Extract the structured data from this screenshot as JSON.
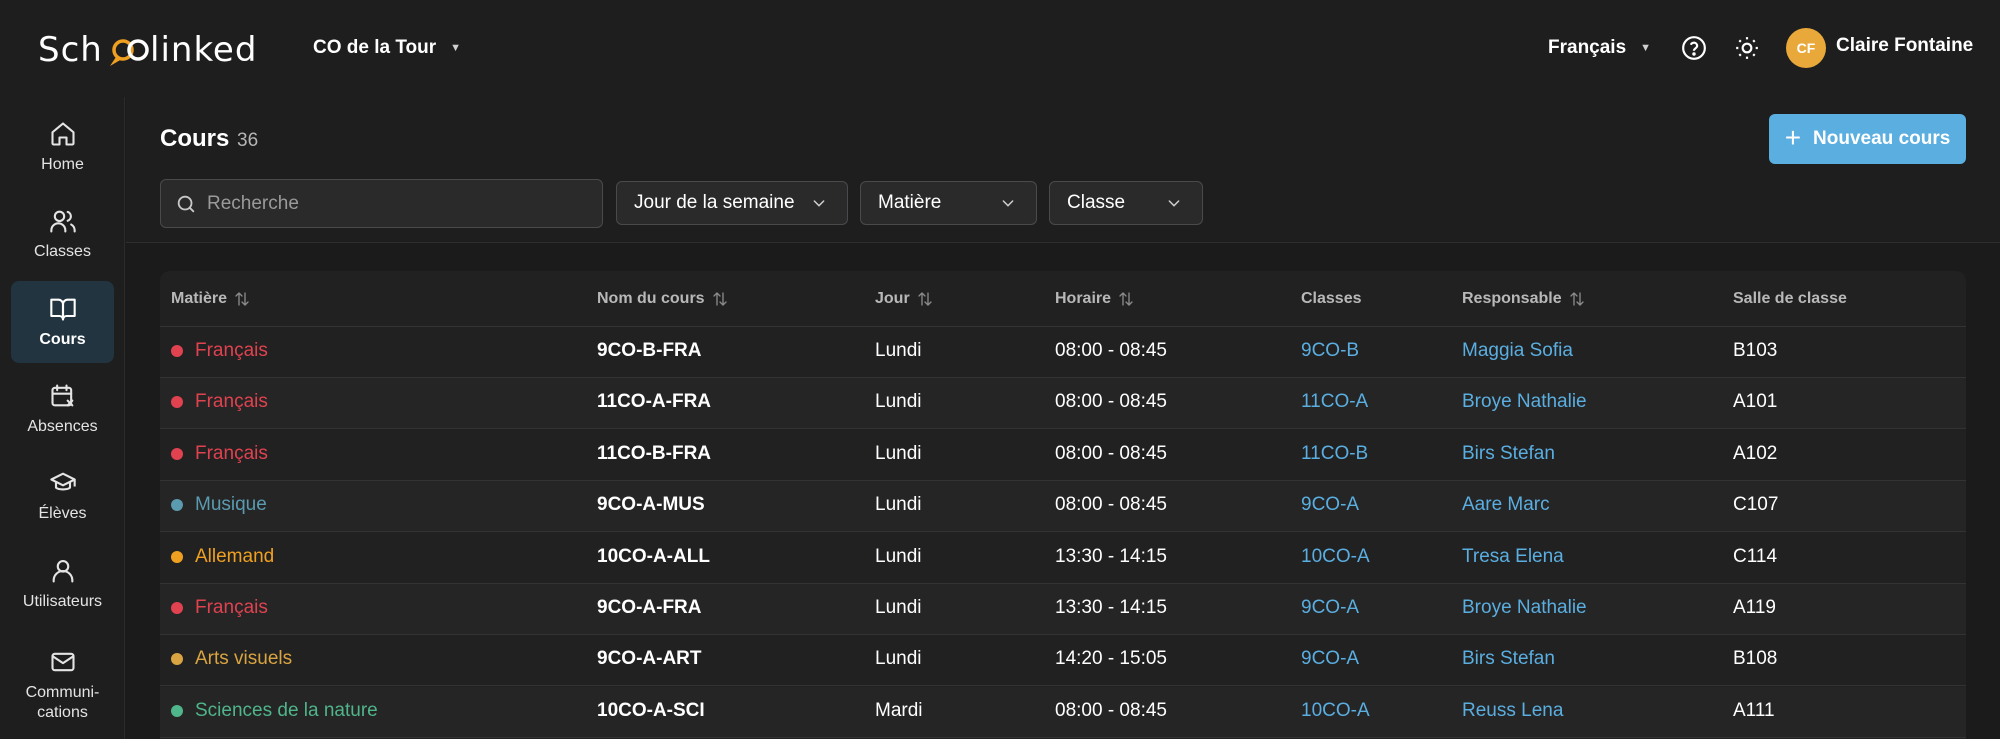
{
  "header": {
    "school": "CO de la Tour",
    "language": "Français",
    "user_initials": "CF",
    "user_name": "Claire Fontaine",
    "avatar_color": "#e8a93a"
  },
  "sidebar": {
    "items": [
      {
        "label": "Home",
        "icon": "home-icon",
        "active": false
      },
      {
        "label": "Classes",
        "icon": "users-icon",
        "active": false
      },
      {
        "label": "Cours",
        "icon": "book-icon",
        "active": true
      },
      {
        "label": "Absences",
        "icon": "calendar-x-icon",
        "active": false
      },
      {
        "label": "Élèves",
        "icon": "graduation-cap-icon",
        "active": false
      },
      {
        "label": "Utilisateurs",
        "icon": "user-icon",
        "active": false
      },
      {
        "label": "Communi-\ncations",
        "icon": "mail-icon",
        "active": false
      }
    ]
  },
  "page": {
    "title": "Cours",
    "count": "36",
    "new_button": "Nouveau cours"
  },
  "filters": {
    "search_placeholder": "Recherche",
    "day": "Jour de la semaine",
    "subject": "Matière",
    "class": "Classe"
  },
  "table": {
    "columns": [
      "Matière",
      "Nom du cours",
      "Jour",
      "Horaire",
      "Classes",
      "Responsable",
      "Salle de classe"
    ],
    "rows": [
      {
        "subject": "Français",
        "color": "#e0424f",
        "course": "9CO-B-FRA",
        "day": "Lundi",
        "time": "08:00 - 08:45",
        "class": "9CO-B",
        "teacher": "Maggia Sofia",
        "room": "B103"
      },
      {
        "subject": "Français",
        "color": "#e0424f",
        "course": "11CO-A-FRA",
        "day": "Lundi",
        "time": "08:00 - 08:45",
        "class": "11CO-A",
        "teacher": "Broye Nathalie",
        "room": "A101"
      },
      {
        "subject": "Français",
        "color": "#e0424f",
        "course": "11CO-B-FRA",
        "day": "Lundi",
        "time": "08:00 - 08:45",
        "class": "11CO-B",
        "teacher": "Birs Stefan",
        "room": "A102"
      },
      {
        "subject": "Musique",
        "color": "#5a9bb0",
        "course": "9CO-A-MUS",
        "day": "Lundi",
        "time": "08:00 - 08:45",
        "class": "9CO-A",
        "teacher": "Aare Marc",
        "room": "C107"
      },
      {
        "subject": "Allemand",
        "color": "#f0a020",
        "course": "10CO-A-ALL",
        "day": "Lundi",
        "time": "13:30 - 14:15",
        "class": "10CO-A",
        "teacher": "Tresa Elena",
        "room": "C114"
      },
      {
        "subject": "Français",
        "color": "#e0424f",
        "course": "9CO-A-FRA",
        "day": "Lundi",
        "time": "13:30 - 14:15",
        "class": "9CO-A",
        "teacher": "Broye Nathalie",
        "room": "A119"
      },
      {
        "subject": "Arts visuels",
        "color": "#d9a441",
        "course": "9CO-A-ART",
        "day": "Lundi",
        "time": "14:20 - 15:05",
        "class": "9CO-A",
        "teacher": "Birs Stefan",
        "room": "B108"
      },
      {
        "subject": "Sciences de la nature",
        "color": "#4fb58a",
        "course": "10CO-A-SCI",
        "day": "Mardi",
        "time": "08:00 - 08:45",
        "class": "10CO-A",
        "teacher": "Reuss Lena",
        "room": "A111"
      }
    ]
  },
  "colors": {
    "accent": "#5aaee0",
    "background": "#1b1b1c"
  }
}
